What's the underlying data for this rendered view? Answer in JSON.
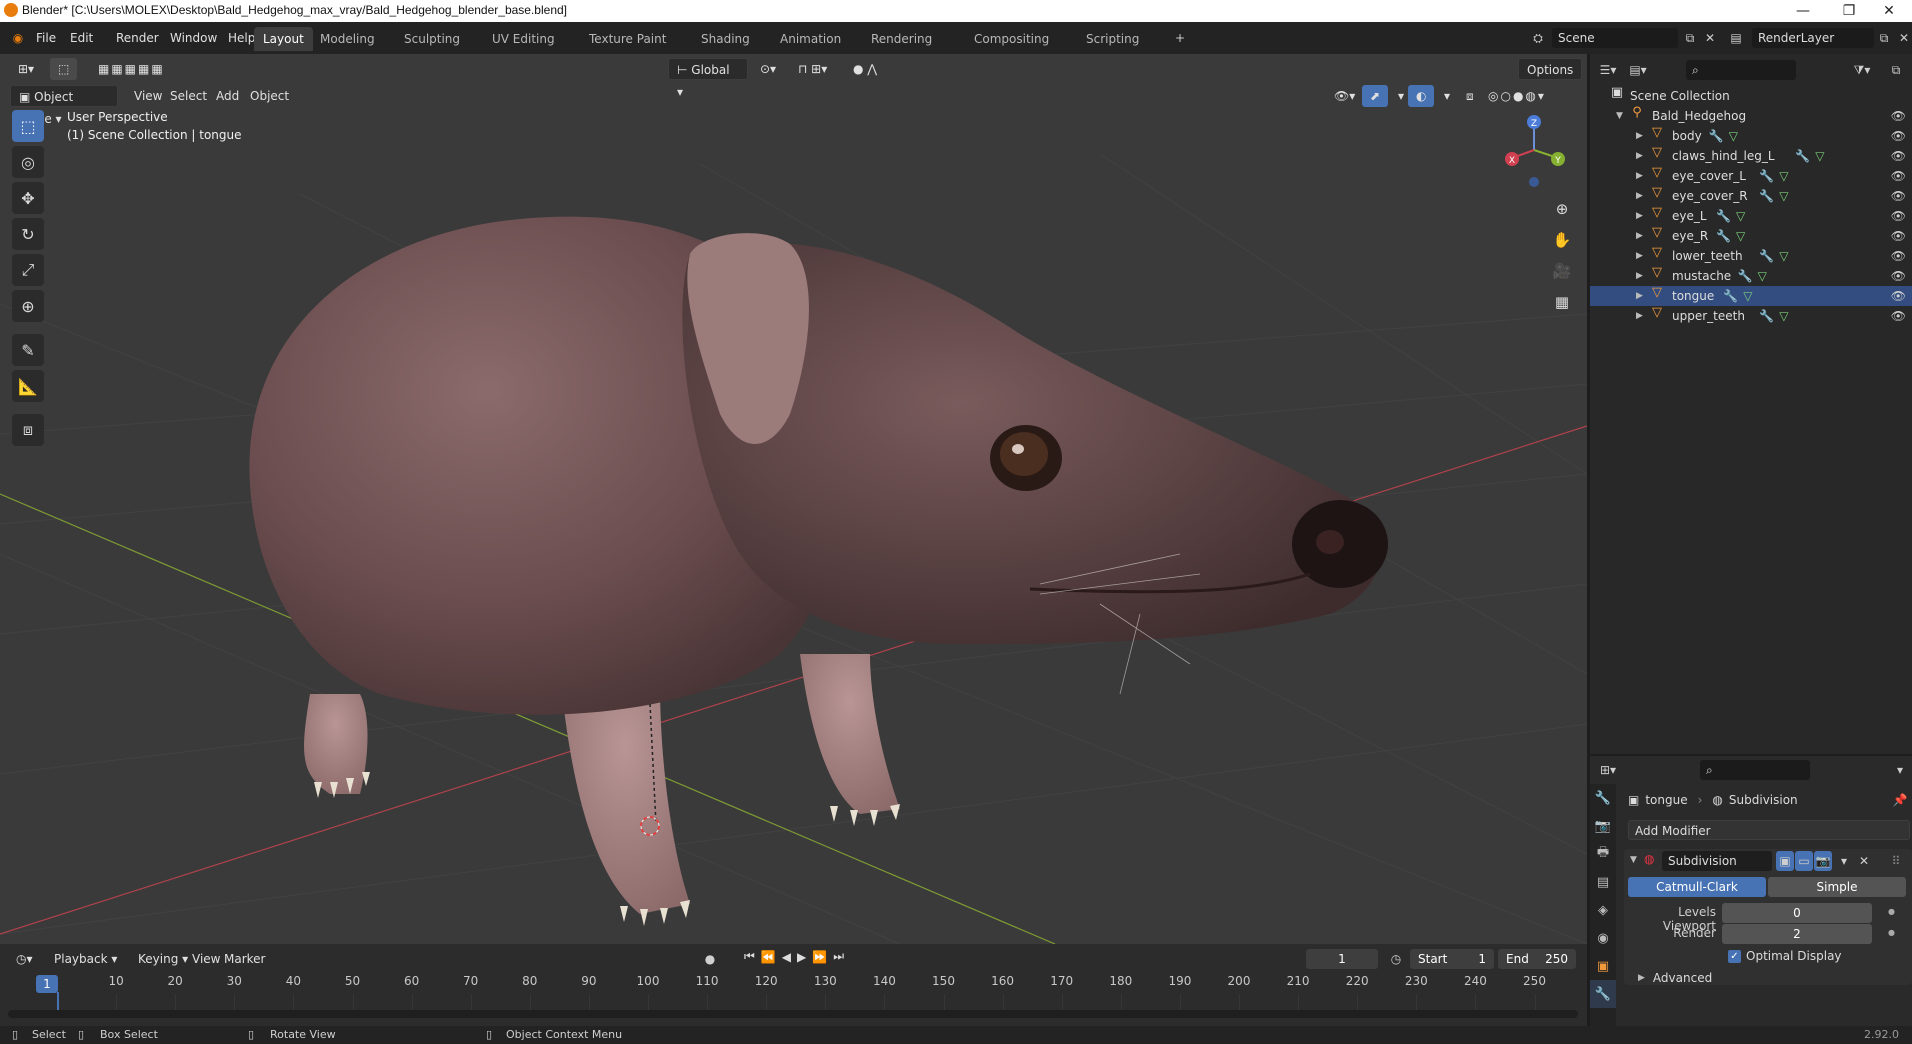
{
  "window": {
    "title": "Blender* [C:\\Users\\MOLEX\\Desktop\\Bald_Hedgehog_max_vray/Bald_Hedgehog_blender_base.blend]",
    "minimize": "—",
    "maximize": "❐",
    "close": "✕"
  },
  "menus": [
    "File",
    "Edit",
    "Render",
    "Window",
    "Help"
  ],
  "workspaces": [
    "Layout",
    "Modeling",
    "Sculpting",
    "UV Editing",
    "Texture Paint",
    "Shading",
    "Animation",
    "Rendering",
    "Compositing",
    "Scripting"
  ],
  "active_workspace": "Layout",
  "add_workspace": "+",
  "scene": {
    "name": "Scene",
    "render_layer": "RenderLayer"
  },
  "viewport": {
    "mode": "Object Mode",
    "menu": [
      "View",
      "Select",
      "Add",
      "Object"
    ],
    "transform_orientation": "Global",
    "options_label": "Options",
    "perspective_label": "User Perspective",
    "collection_label": "(1) Scene Collection | tongue",
    "gizmo_axes": {
      "z": "Z",
      "y": "Y",
      "x": "X"
    }
  },
  "tools": [
    {
      "name": "select-box-tool",
      "glyph": "⬚",
      "active": true
    },
    {
      "name": "cursor-tool",
      "glyph": "◎"
    },
    {
      "name": "move-tool",
      "glyph": "✥"
    },
    {
      "name": "rotate-tool",
      "glyph": "↻"
    },
    {
      "name": "scale-tool",
      "glyph": "⤢"
    },
    {
      "name": "transform-tool",
      "glyph": "⊕"
    },
    {
      "name": "annotate-tool",
      "glyph": "✎"
    },
    {
      "name": "measure-tool",
      "glyph": "📐"
    },
    {
      "name": "add-cube-tool",
      "glyph": "⧈"
    }
  ],
  "outliner": {
    "root": "Scene Collection",
    "collection": "Bald_Hedgehog",
    "items": [
      "body",
      "claws_hind_leg_L",
      "eye_cover_L",
      "eye_cover_R",
      "eye_L",
      "eye_R",
      "lower_teeth",
      "mustache",
      "tongue",
      "upper_teeth"
    ],
    "selected": "tongue"
  },
  "properties": {
    "object_name": "tongue",
    "modifier_crumb": "Subdivision",
    "add_modifier": "Add Modifier",
    "modifier_name": "Subdivision",
    "type_catmull": "Catmull-Clark",
    "type_simple": "Simple",
    "levels_viewport_label": "Levels Viewport",
    "levels_viewport_value": "0",
    "render_label": "Render",
    "render_value": "2",
    "optimal_display": "Optimal Display",
    "advanced": "Advanced"
  },
  "timeline": {
    "menu": [
      "Playback",
      "Keying",
      "View",
      "Marker"
    ],
    "current_frame": "1",
    "start_label": "Start",
    "start": "1",
    "end_label": "End",
    "end": "250",
    "ruler": [
      "10",
      "20",
      "30",
      "40",
      "50",
      "60",
      "70",
      "80",
      "90",
      "100",
      "110",
      "120",
      "130",
      "140",
      "150",
      "160",
      "170",
      "180",
      "190",
      "200",
      "210",
      "220",
      "230",
      "240",
      "250"
    ],
    "playhead": "1"
  },
  "statusbar": {
    "select": "Select",
    "box_select": "Box Select",
    "rotate_view": "Rotate View",
    "context_menu": "Object Context Menu",
    "version": "2.92.0"
  },
  "colors": {
    "accent": "#4772b3",
    "selected_row": "#334d80",
    "object_orange": "#f09a3e",
    "x_axis": "#d04050",
    "y_axis": "#86b030"
  }
}
